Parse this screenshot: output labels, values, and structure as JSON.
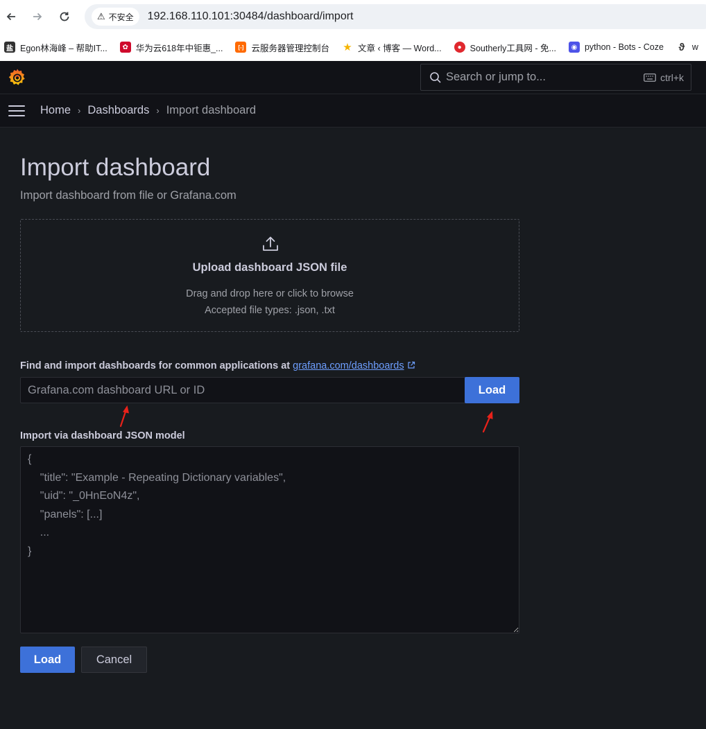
{
  "browser": {
    "back_icon": "arrow-left-icon",
    "forward_icon": "arrow-right-icon",
    "reload_icon": "reload-icon",
    "security_label": "不安全",
    "url": "192.168.110.101:30484/dashboard/import",
    "bookmarks": [
      {
        "label": "Egon林海峰 – 帮助IT...",
        "color": "#333333",
        "glyph": "盐"
      },
      {
        "label": "华为云618年中钜惠_...",
        "color": "#cf0a2c",
        "glyph": "✿"
      },
      {
        "label": "云服务器管理控制台",
        "color": "#ff6a00",
        "glyph": "[-]"
      },
      {
        "label": "文章 ‹ 博客 — Word...",
        "color": "#f5b400",
        "glyph": "★"
      },
      {
        "label": "Southerly工具网 - 免...",
        "color": "#e0282e",
        "glyph": "●"
      },
      {
        "label": "python - Bots - Coze",
        "color": "#4d53e8",
        "glyph": "◉"
      },
      {
        "label": "w",
        "color": "#333333",
        "glyph": "ϑ"
      }
    ]
  },
  "topbar": {
    "search_placeholder": "Search or jump to...",
    "shortcut": "ctrl+k"
  },
  "breadcrumb": {
    "items": [
      "Home",
      "Dashboards",
      "Import dashboard"
    ],
    "separator": "›"
  },
  "page": {
    "title": "Import dashboard",
    "subtitle": "Import dashboard from file or Grafana.com"
  },
  "upload": {
    "title": "Upload dashboard JSON file",
    "hint": "Drag and drop here or click to browse",
    "accepted": "Accepted file types: .json, .txt"
  },
  "grafana_com": {
    "label": "Find and import dashboards for common applications at",
    "link_text": "grafana.com/dashboards",
    "placeholder": "Grafana.com dashboard URL or ID",
    "load_label": "Load"
  },
  "json_model": {
    "label": "Import via dashboard JSON model",
    "placeholder": "{\n    \"title\": \"Example - Repeating Dictionary variables\",\n    \"uid\": \"_0HnEoN4z\",\n    \"panels\": [...]\n    ...\n}"
  },
  "actions": {
    "load_label": "Load",
    "cancel_label": "Cancel"
  },
  "colors": {
    "primary": "#3d71d9",
    "link": "#6e9fff",
    "annotation_arrow": "#e8221a",
    "background": "#181b1f"
  }
}
